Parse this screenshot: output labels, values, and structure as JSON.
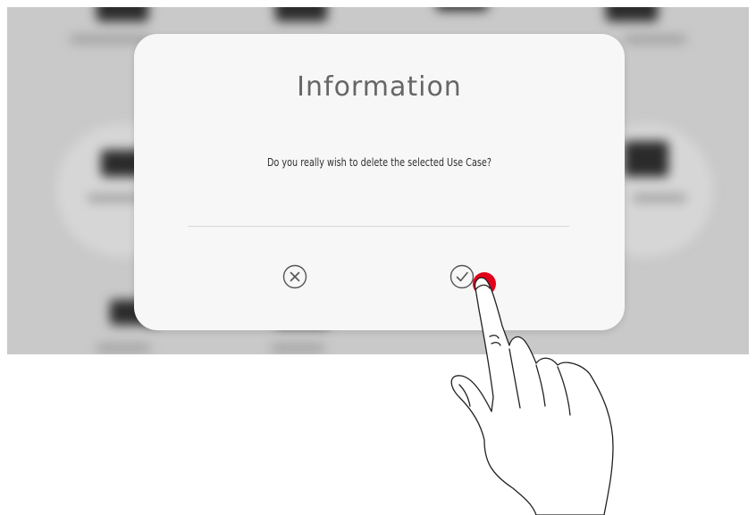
{
  "dialog": {
    "title": "Information",
    "message": "Do you really wish to delete the selected Use Case?",
    "cancel_icon": "cancel-x-circle-icon",
    "confirm_icon": "confirm-check-circle-icon"
  },
  "colors": {
    "dialog_background": "#f7f7f7",
    "backdrop": "#c9c9c9",
    "icon_stroke": "#555555",
    "touch_indicator": "#e2001a"
  }
}
